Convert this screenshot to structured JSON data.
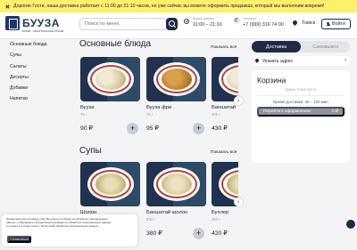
{
  "banner": {
    "text": "Дорогие Гости, наша доставка работает с 11:00 до 21:10 часов, но уже сейчас вы можете оформить предзаказ, который мы выполним вовремя!"
  },
  "header": {
    "brand": "БУУЗА",
    "brand_sub": "БУРЯТ · МОНГОЛЬСКАЯ КУХНЯ",
    "search_placeholder": "Поиск по меню",
    "hours_label": "Время работы",
    "hours_value": "11:00 – 21:10",
    "phone_label": "Телефон",
    "phone_value": "+7 (999) 316 74 00",
    "city": "Томск",
    "login_label": "Войти"
  },
  "sidebar": {
    "items": [
      "Основные блюда",
      "Супы",
      "Салаты",
      "Десерты",
      "Добавки",
      "Напитки"
    ]
  },
  "sections": [
    {
      "title": "Основные блюда",
      "show_all": "Показать всё",
      "cards": [
        {
          "name": "Бууза",
          "weight": "75 г",
          "price": "90 ₽"
        },
        {
          "name": "Бууза фри",
          "weight": "75 г",
          "price": "95 ₽"
        },
        {
          "name": "Баншатай",
          "weight": "485 г",
          "price": "430 ₽"
        }
      ]
    },
    {
      "title": "Супы",
      "show_all": "Показать всё",
      "cards": [
        {
          "name": "Шолон",
          "weight": "",
          "price": ""
        },
        {
          "name": "Баншатай шолон",
          "weight": "430 г",
          "price": "380 ₽"
        },
        {
          "name": "Бухлер",
          "weight": "450 г",
          "price": "420 ₽"
        }
      ]
    }
  ],
  "right_panel": {
    "tab_delivery": "Доставка",
    "tab_pickup": "Самовывоз",
    "address": "Указать адрес",
    "cart_title": "Корзина",
    "cart_empty": "Здесь пока пусто",
    "delivery_time": "Время доставки: 40 – 100 мин",
    "checkout_label": "Перейти к оформлению",
    "checkout_total": "0 ₽"
  },
  "cookie": {
    "text": "Продолжая использовать сайт, Вы даете согласие на обработку персональных данных, собираемых посредством программ по обработке персональных данных и cookies в соответствии с Политикой обработки персональных данных.",
    "accept": "Согласиться"
  },
  "colors": {
    "accent": "#1e2a44",
    "banner": "#fdf06a",
    "background": "#f4f4f6"
  }
}
